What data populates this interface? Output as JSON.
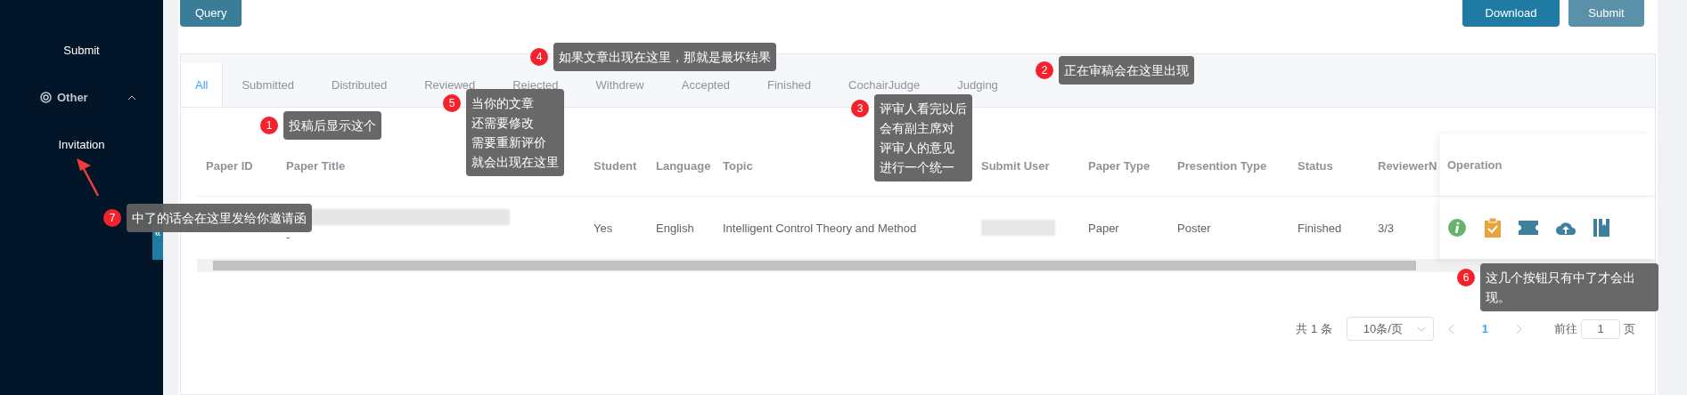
{
  "sidebar": {
    "items": [
      {
        "label": "Submit",
        "kind": "link"
      },
      {
        "label": "Other",
        "kind": "group",
        "expanded": true
      },
      {
        "label": "Invitation",
        "kind": "link"
      }
    ],
    "collapse_button": "«"
  },
  "toolbar": {
    "query_button": "Query",
    "download_button": "Download",
    "submit_button": "Submit"
  },
  "tabs": [
    {
      "label": "All",
      "selected": true
    },
    {
      "label": "Submitted",
      "selected": false
    },
    {
      "label": "Distributed",
      "selected": false
    },
    {
      "label": "Reviewed",
      "selected": false
    },
    {
      "label": "Rejected",
      "selected": false
    },
    {
      "label": "Withdrew",
      "selected": false
    },
    {
      "label": "Accepted",
      "selected": false
    },
    {
      "label": "Finished",
      "selected": false
    },
    {
      "label": "CochairJudge",
      "selected": false
    },
    {
      "label": "Judging",
      "selected": false
    }
  ],
  "table": {
    "columns": [
      "Paper ID",
      "Paper Title",
      "Student",
      "Language",
      "Topic",
      "Submit User",
      "Paper Type",
      "Presention Type",
      "Status",
      "ReviewerN",
      "Operation"
    ],
    "rows": [
      {
        "cells": [
          {
            "kind": "empty"
          },
          {
            "kind": "blurred",
            "text": "-"
          },
          {
            "kind": "text",
            "text": "Yes"
          },
          {
            "kind": "text",
            "text": "English"
          },
          {
            "kind": "text",
            "text": "Intelligent Control Theory and Method"
          },
          {
            "kind": "blurred"
          },
          {
            "kind": "text",
            "text": "Paper"
          },
          {
            "kind": "text",
            "text": "Poster"
          },
          {
            "kind": "text",
            "text": "Finished"
          },
          {
            "kind": "text",
            "text": "3/3"
          },
          {
            "kind": "actions",
            "actions": [
              {
                "kind": "info"
              },
              {
                "kind": "clipboard"
              },
              {
                "kind": "ticket"
              },
              {
                "kind": "upload"
              },
              {
                "kind": "book"
              }
            ]
          }
        ]
      }
    ]
  },
  "pagination": {
    "total": "共 1 条",
    "page_size": "10条/页",
    "pages": [
      {
        "label": "1",
        "selected": true
      }
    ],
    "goto_label": "前往",
    "goto_value": "1",
    "goto_suffix": "页"
  },
  "annotations": [
    {
      "number": "1",
      "lines": [
        "投稿后显示这个"
      ]
    },
    {
      "number": "2",
      "lines": [
        "正在审稿会在这里出现"
      ]
    },
    {
      "number": "3",
      "lines": [
        "评审人看完以后",
        "会有副主席对",
        "评审人的意见",
        "进行一个统一"
      ]
    },
    {
      "number": "4",
      "lines": [
        "如果文章出现在这里，那就是最坏结果"
      ]
    },
    {
      "number": "5",
      "lines": [
        "当你的文章",
        "还需要修改",
        "需要重新评价",
        "就会出现在这里"
      ]
    },
    {
      "number": "6",
      "lines": [
        "这几个按钮只有中了才会出现。"
      ]
    },
    {
      "number": "7",
      "lines": [
        "中了的话会在这里发给你邀请函"
      ]
    }
  ]
}
